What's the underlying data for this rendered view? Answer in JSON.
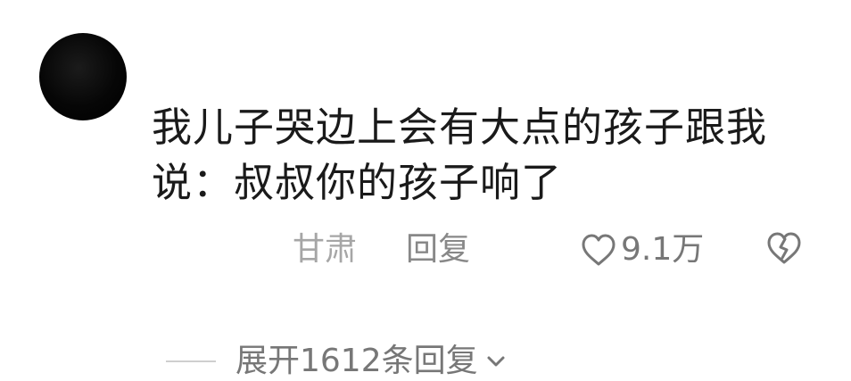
{
  "comment": {
    "text": "我儿子哭边上会有大点的孩子跟我说：叔叔你的孩子响了",
    "location": "甘肃",
    "reply_label": "回复",
    "like_count": "9.1万",
    "icons": {
      "like": "heart-outline-icon",
      "dislike": "broken-heart-icon",
      "expand": "chevron-down-icon"
    }
  },
  "replies": {
    "expand_label": "展开1612条回复"
  },
  "colors": {
    "text": "#1a1a1a",
    "muted": "#888888",
    "location": "#a6a6a6",
    "avatar": "#000000"
  }
}
